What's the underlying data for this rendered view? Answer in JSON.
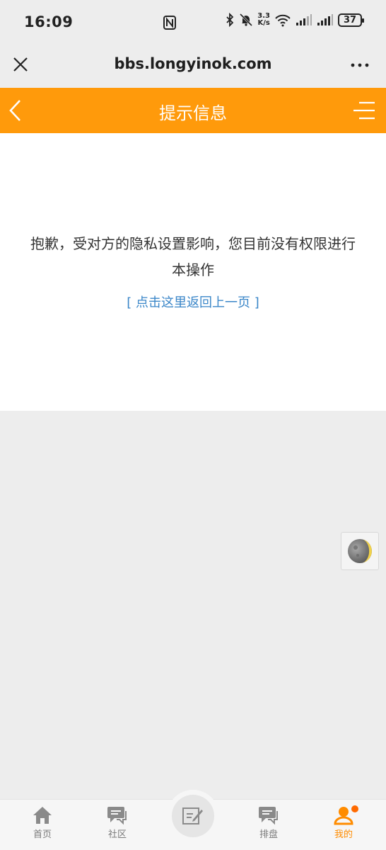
{
  "status_bar": {
    "time": "16:09",
    "speed_value": "3.3",
    "speed_unit": "K/s",
    "battery": "37",
    "icons": [
      "nfc-icon",
      "bluetooth-icon",
      "mute-icon",
      "wifi-icon",
      "signal-icon",
      "signal-icon",
      "battery-icon"
    ]
  },
  "browser": {
    "url": "bbs.longyinok.com",
    "close_icon": "close-icon",
    "more_icon": "more-dots-icon"
  },
  "header": {
    "title": "提示信息",
    "back_icon": "chevron-left-icon",
    "menu_icon": "menu-icon",
    "color": "#ff9a0b"
  },
  "content": {
    "message": "抱歉，受对方的隐私设置影响，您目前没有权限进行本操作",
    "back_link": "[ 点击这里返回上一页 ]",
    "link_color": "#3a86c8"
  },
  "float": {
    "night_mode_icon": "moon-icon"
  },
  "bottom_nav": {
    "items": [
      {
        "label": "首页",
        "icon": "home-icon"
      },
      {
        "label": "社区",
        "icon": "chat-icon"
      },
      {
        "label": "",
        "icon": "edit-icon"
      },
      {
        "label": "排盘",
        "icon": "chat-icon"
      },
      {
        "label": "我的",
        "icon": "user-icon"
      }
    ],
    "active_color": "#ff8c00"
  }
}
